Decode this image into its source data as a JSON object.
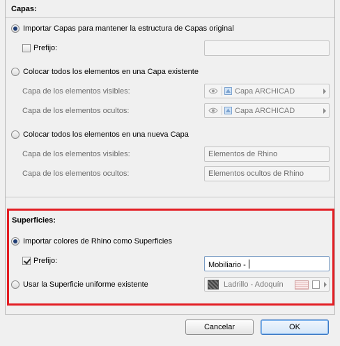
{
  "layers": {
    "heading": "Capas:",
    "import_option": "Importar Capas para mantener la estructura de Capas original",
    "prefix_label": "Prefijo:",
    "prefix_value": "",
    "existing_option": "Colocar todos los elementos en una Capa existente",
    "visible_label": "Capa de los elementos visibles:",
    "hidden_label": "Capa de los elementos ocultos:",
    "visible_existing_value": "Capa ARCHICAD",
    "hidden_existing_value": "Capa ARCHICAD",
    "new_option": "Colocar todos los elementos en una nueva Capa",
    "visible_new_value": "Elementos de Rhino",
    "hidden_new_value": "Elementos ocultos de Rhino",
    "selected": "import"
  },
  "surfaces": {
    "heading": "Superficies:",
    "import_option": "Importar colores de Rhino como Superficies",
    "prefix_label": "Prefijo:",
    "prefix_checked": true,
    "prefix_value": "Mobiliario - ",
    "existing_option": "Usar la Superficie uniforme existente",
    "surface_value": "Ladrillo - Adoquín",
    "selected": "import"
  },
  "buttons": {
    "cancel": "Cancelar",
    "ok": "OK"
  },
  "colors": {
    "highlight": "#e31e24",
    "primary_border": "#3a78c4"
  },
  "icons": {
    "eye": "eye-icon",
    "layer": "layer-icon",
    "surface_swatch": "surface-swatch-icon",
    "dropdown_arrow": "chevron-right-icon"
  }
}
